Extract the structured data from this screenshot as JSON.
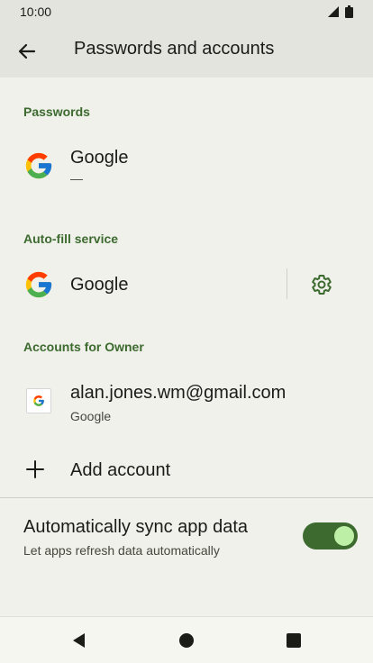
{
  "status_bar": {
    "time": "10:00"
  },
  "app_bar": {
    "title": "Passwords and accounts"
  },
  "passwords": {
    "header": "Passwords",
    "item": {
      "title": "Google",
      "subtitle": "—"
    }
  },
  "autofill": {
    "header": "Auto-fill service",
    "item": {
      "title": "Google"
    }
  },
  "accounts": {
    "header": "Accounts for Owner",
    "item": {
      "title": "alan.jones.wm@gmail.com",
      "subtitle": "Google"
    },
    "add_label": "Add account"
  },
  "sync": {
    "title": "Automatically sync app data",
    "subtitle": "Let apps refresh data automatically",
    "enabled": true
  },
  "colors": {
    "accent": "#3c6a2f",
    "toggle_knob": "#bdf0a6",
    "background": "#f0f1ea",
    "bar": "#e3e4dd"
  },
  "icons": [
    "signal-icon",
    "battery-icon",
    "back-arrow-icon",
    "google-logo-icon",
    "gear-icon",
    "google-avatar-icon",
    "plus-icon",
    "nav-back-icon",
    "nav-home-icon",
    "nav-recents-icon"
  ]
}
